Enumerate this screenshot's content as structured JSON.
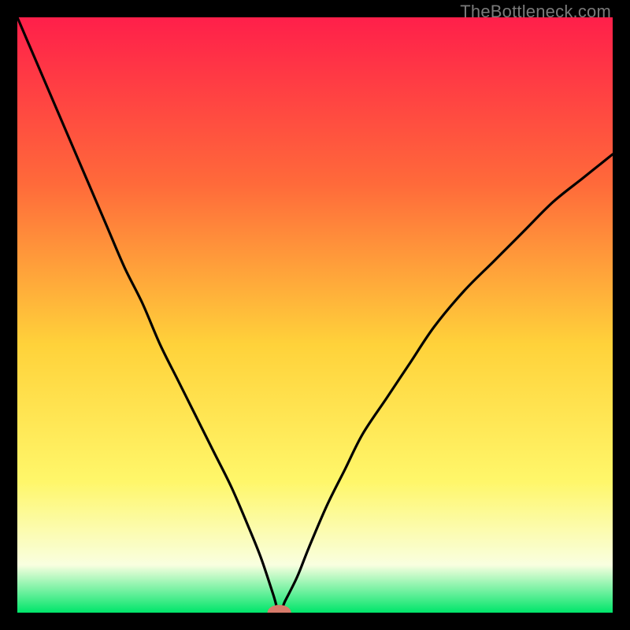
{
  "watermark": "TheBottleneck.com",
  "colors": {
    "grad_top": "#ff1f4a",
    "grad_mid_upper": "#ff6a3a",
    "grad_mid": "#ffd23a",
    "grad_mid_lower": "#fff76a",
    "grad_lower": "#f9ffe0",
    "grad_bottom": "#00e56a",
    "curve": "#000000",
    "marker": "#d77a6a",
    "frame": "#000000"
  },
  "chart_data": {
    "type": "line",
    "title": "",
    "xlabel": "",
    "ylabel": "",
    "xlim": [
      0,
      100
    ],
    "ylim": [
      0,
      100
    ],
    "optimum_x": 44,
    "series": [
      {
        "name": "bottleneck-curve",
        "x": [
          0,
          3,
          6,
          9,
          12,
          15,
          18,
          21,
          24,
          27,
          30,
          33,
          36,
          39,
          41,
          43,
          44,
          45,
          47,
          49,
          52,
          55,
          58,
          62,
          66,
          70,
          75,
          80,
          85,
          90,
          95,
          100
        ],
        "values": [
          100,
          93,
          86,
          79,
          72,
          65,
          58,
          52,
          45,
          39,
          33,
          27,
          21,
          14,
          9,
          3,
          0,
          2,
          6,
          11,
          18,
          24,
          30,
          36,
          42,
          48,
          54,
          59,
          64,
          69,
          73,
          77
        ]
      }
    ],
    "marker": {
      "x": 44,
      "y": 0,
      "rx": 2.0,
      "ry": 1.3
    }
  }
}
